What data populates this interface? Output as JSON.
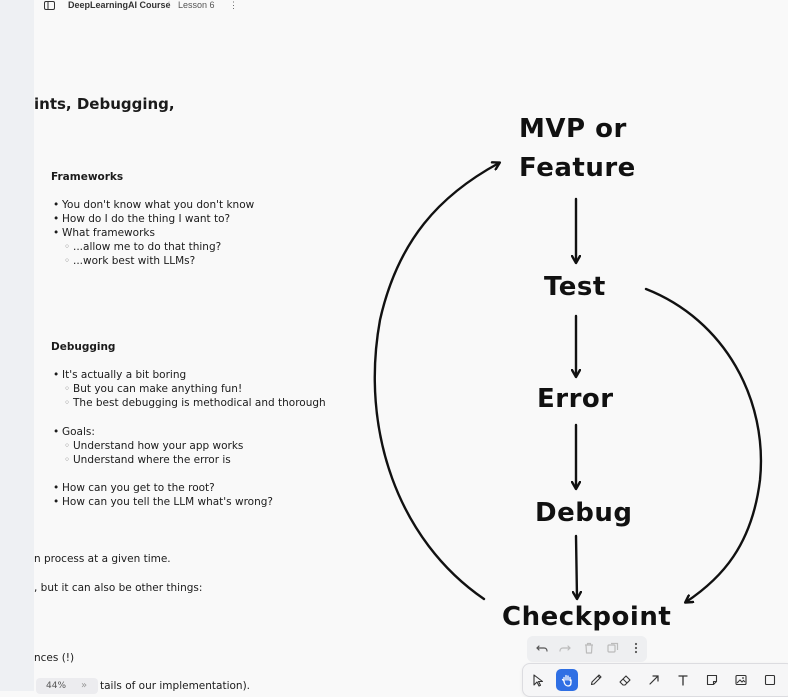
{
  "breadcrumb": {
    "course": "DeepLearningAI Course",
    "separator": "/",
    "lesson": "Lesson 6",
    "more": "⋮"
  },
  "notes": {
    "title": "ints, Debugging,",
    "frameworks": {
      "heading": "Frameworks",
      "items": [
        "You don't know what you don't know",
        "How do I do the thing I want to?",
        "What frameworks"
      ],
      "subitems": [
        "...allow me to do that thing?",
        "...work best with LLMs?"
      ]
    },
    "debugging": {
      "heading": "Debugging",
      "item1": "It's actually a bit boring",
      "item1_subs": [
        "But you can make anything fun!",
        "The best debugging is methodical and thorough"
      ],
      "item2": "Goals:",
      "item2_subs": [
        "Understand how your app works",
        "Understand where the error is"
      ],
      "item3": "How can you get to the root?",
      "item4": "How can you tell the LLM what's wrong?"
    },
    "fragments": [
      "n process at a given time.",
      ", but it can also be other things:",
      "nces (!)",
      "tails of our implementation)."
    ]
  },
  "flow": {
    "nodes": [
      "MVP or",
      "Feature",
      "Test",
      "Error",
      "Debug",
      "Checkpoint"
    ]
  },
  "zoom": {
    "level": "44%",
    "collapse": "»"
  },
  "toolbar": {
    "tools": [
      "select-tool",
      "hand-tool",
      "pen-tool",
      "eraser-tool",
      "arrow-tool",
      "text-tool",
      "note-tool",
      "image-tool",
      "frame-tool"
    ],
    "active": "hand-tool",
    "accent": "#2f6fe4"
  }
}
